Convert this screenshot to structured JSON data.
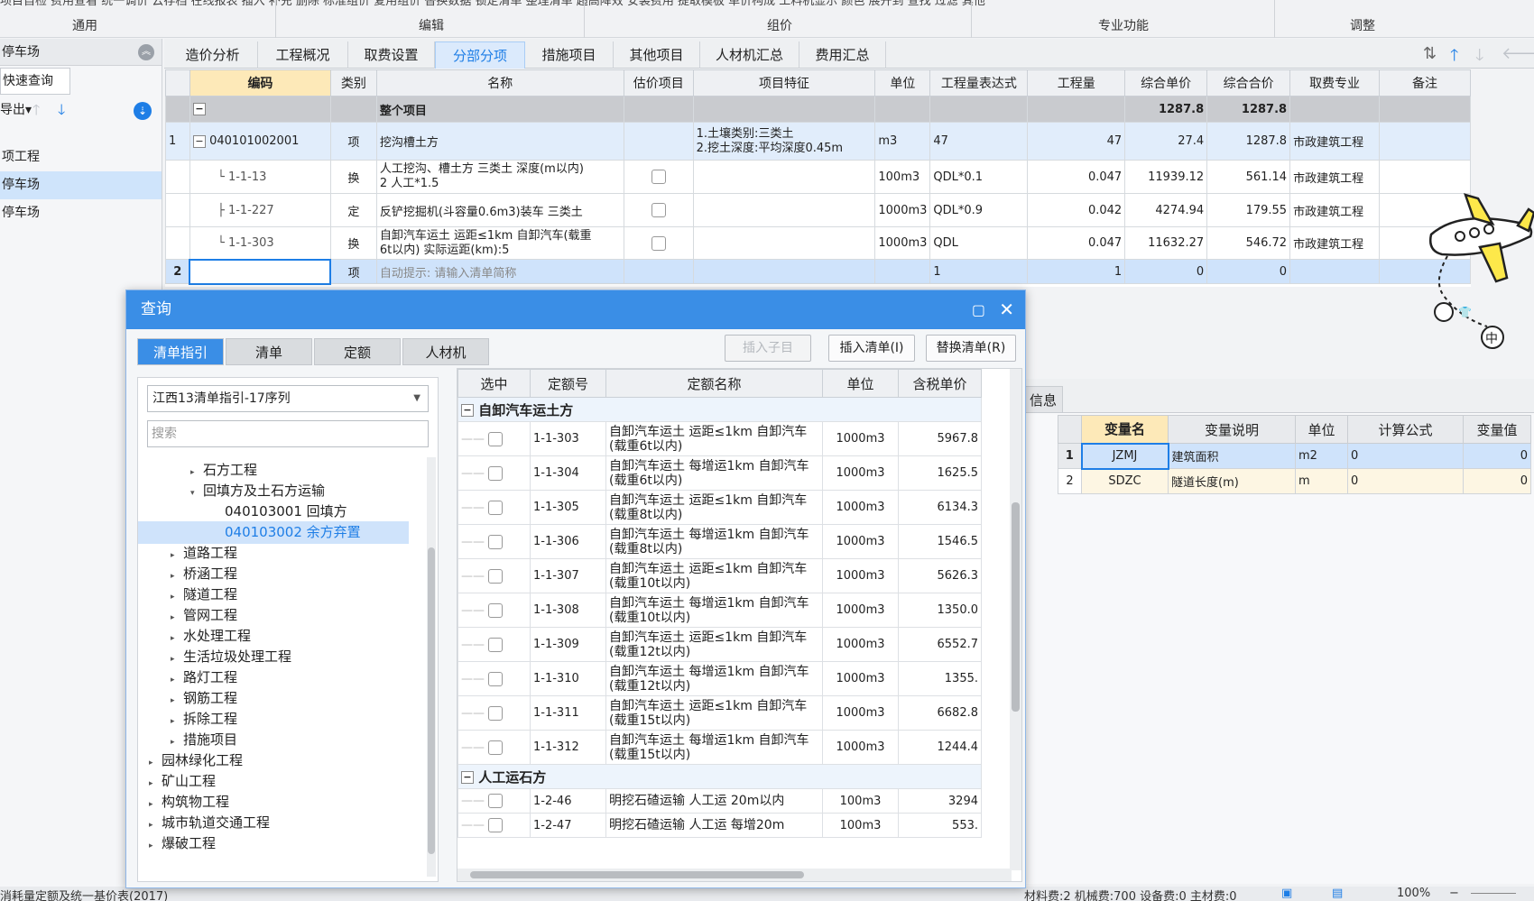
{
  "ribbon": {
    "truncated_top": "项目自检   费用查看   统一调价   云存档   在线报表   插入   补充   删除   标准组价   复用组价   替换数据   锁定清单   整理清单   超高降效   安装费用   提取模板   单价构成   工料机显示   颜色   展开到   查找   过滤   其他",
    "groups": [
      "通用",
      "编辑",
      "组价",
      "专业功能",
      "调整"
    ]
  },
  "left_panel": {
    "header": "停车场",
    "quick_query": "快速查询",
    "export": "导出",
    "items": [
      {
        "label": "项工程",
        "selected": false
      },
      {
        "label": "停车场",
        "selected": true
      },
      {
        "label": "停车场",
        "selected": false
      }
    ]
  },
  "tabs": [
    "造价分析",
    "工程概况",
    "取费设置",
    "分部分项",
    "措施项目",
    "其他项目",
    "人材机汇总",
    "费用汇总"
  ],
  "active_tab": "分部分项",
  "main_grid": {
    "headers": [
      "编码",
      "类别",
      "名称",
      "估价项目",
      "项目特征",
      "单位",
      "工程量表达式",
      "工程量",
      "综合单价",
      "综合合价",
      "取费专业",
      "备注"
    ],
    "total_row": {
      "toggle": "−",
      "name": "整个项目",
      "unit_price": "1287.8",
      "total": "1287.8"
    },
    "row1": {
      "index": "1",
      "toggle": "−",
      "code": "040101002001",
      "type": "项",
      "name": "挖沟槽土方",
      "feature1": "1.土壤类别:三类土",
      "feature2": "2.挖土深度:平均深度0.45m",
      "unit": "m3",
      "expr": "47",
      "qty": "47",
      "unit_price": "27.4",
      "total": "1287.8",
      "category": "市政建筑工程"
    },
    "subrows": [
      {
        "code": "1-1-13",
        "type": "换",
        "name1": "人工挖沟、槽土方 三类土 深度(m以内)",
        "name2": "2  人工*1.5",
        "unit": "100m3",
        "expr": "QDL*0.1",
        "qty": "0.047",
        "unit_price": "11939.12",
        "total": "561.14",
        "category": "市政建筑工程"
      },
      {
        "code": "1-1-227",
        "type": "定",
        "name1": "反铲挖掘机(斗容量0.6m3)装车 三类土",
        "name2": "",
        "unit": "1000m3",
        "expr": "QDL*0.9",
        "qty": "0.042",
        "unit_price": "4274.94",
        "total": "179.55",
        "category": "市政建筑工程"
      },
      {
        "code": "1-1-303",
        "type": "换",
        "name1": "自卸汽车运土 运距≤1km 自卸汽车(载重",
        "name2": "6t以内) 实际运距(km):5",
        "unit": "1000m3",
        "expr": "QDL",
        "qty": "0.047",
        "unit_price": "11632.27",
        "total": "546.72",
        "category": "市政建筑工程"
      }
    ],
    "row2": {
      "index": "2",
      "type": "项",
      "hint": "自动提示: 请输入清单简称",
      "expr": "1",
      "qty": "1",
      "unit_price": "0",
      "total": "0"
    }
  },
  "right_panel": {
    "tab": "信息",
    "headers": [
      "变量名",
      "变量说明",
      "单位",
      "计算公式",
      "变量值"
    ],
    "rows": [
      {
        "idx": "1",
        "name": "JZMJ",
        "desc": "建筑面积",
        "unit": "m2",
        "formula": "0",
        "value": "0"
      },
      {
        "idx": "2",
        "name": "SDZC",
        "desc": "隧道长度(m)",
        "unit": "m",
        "formula": "0",
        "value": "0"
      }
    ]
  },
  "mascot_label": "中",
  "dialog": {
    "title": "查询",
    "tabs": [
      "清单指引",
      "清单",
      "定额",
      "人材机"
    ],
    "buttons": {
      "insert_child": "插入子目",
      "insert_list": "插入清单(I)",
      "replace_list": "替换清单(R)"
    },
    "select_value": "江西13清单指引-17序列",
    "search_placeholder": "搜索",
    "tree": [
      {
        "label": "石方工程",
        "level": 2,
        "icon": "▸",
        "selected": false
      },
      {
        "label": "回填方及土石方运输",
        "level": 2,
        "icon": "▾",
        "selected": false
      },
      {
        "label": "040103001  回填方",
        "level": 3,
        "icon": "",
        "selected": false
      },
      {
        "label": "040103002  余方弃置",
        "level": 3,
        "icon": "",
        "selected": true
      },
      {
        "label": "道路工程",
        "level": 1,
        "icon": "▸",
        "selected": false
      },
      {
        "label": "桥涵工程",
        "level": 1,
        "icon": "▸",
        "selected": false
      },
      {
        "label": "隧道工程",
        "level": 1,
        "icon": "▸",
        "selected": false
      },
      {
        "label": "管网工程",
        "level": 1,
        "icon": "▸",
        "selected": false
      },
      {
        "label": "水处理工程",
        "level": 1,
        "icon": "▸",
        "selected": false
      },
      {
        "label": "生活垃圾处理工程",
        "level": 1,
        "icon": "▸",
        "selected": false
      },
      {
        "label": "路灯工程",
        "level": 1,
        "icon": "▸",
        "selected": false
      },
      {
        "label": "钢筋工程",
        "level": 1,
        "icon": "▸",
        "selected": false
      },
      {
        "label": "拆除工程",
        "level": 1,
        "icon": "▸",
        "selected": false
      },
      {
        "label": "措施项目",
        "level": 1,
        "icon": "▸",
        "selected": false
      },
      {
        "label": "园林绿化工程",
        "level": 0,
        "icon": "▸",
        "selected": false
      },
      {
        "label": "矿山工程",
        "level": 0,
        "icon": "▸",
        "selected": false
      },
      {
        "label": "构筑物工程",
        "level": 0,
        "icon": "▸",
        "selected": false
      },
      {
        "label": "城市轨道交通工程",
        "level": 0,
        "icon": "▸",
        "selected": false
      },
      {
        "label": "爆破工程",
        "level": 0,
        "icon": "▸",
        "selected": false
      }
    ],
    "grid_headers": [
      "选中",
      "定额号",
      "定额名称",
      "单位",
      "含税单价"
    ],
    "groups": [
      {
        "name": "自卸汽车运土方",
        "rows": [
          {
            "code": "1-1-303",
            "name1": "自卸汽车运土 运距≤1km 自卸汽车",
            "name2": "(载重6t以内)",
            "unit": "1000m3",
            "price": "5967.8"
          },
          {
            "code": "1-1-304",
            "name1": "自卸汽车运土 每增运1km 自卸汽车",
            "name2": "(载重6t以内)",
            "unit": "1000m3",
            "price": "1625.5"
          },
          {
            "code": "1-1-305",
            "name1": "自卸汽车运土 运距≤1km 自卸汽车",
            "name2": "(载重8t以内)",
            "unit": "1000m3",
            "price": "6134.3"
          },
          {
            "code": "1-1-306",
            "name1": "自卸汽车运土 每增运1km 自卸汽车",
            "name2": "(载重8t以内)",
            "unit": "1000m3",
            "price": "1546.5"
          },
          {
            "code": "1-1-307",
            "name1": "自卸汽车运土 运距≤1km 自卸汽车",
            "name2": "(载重10t以内)",
            "unit": "1000m3",
            "price": "5626.3"
          },
          {
            "code": "1-1-308",
            "name1": "自卸汽车运土 每增运1km 自卸汽车",
            "name2": "(载重10t以内)",
            "unit": "1000m3",
            "price": "1350.0"
          },
          {
            "code": "1-1-309",
            "name1": "自卸汽车运土 运距≤1km 自卸汽车",
            "name2": "(载重12t以内)",
            "unit": "1000m3",
            "price": "6552.7"
          },
          {
            "code": "1-1-310",
            "name1": "自卸汽车运土 每增运1km 自卸汽车",
            "name2": "(载重12t以内)",
            "unit": "1000m3",
            "price": "1355."
          },
          {
            "code": "1-1-311",
            "name1": "自卸汽车运土 运距≤1km 自卸汽车",
            "name2": "(载重15t以内)",
            "unit": "1000m3",
            "price": "6682.8"
          },
          {
            "code": "1-1-312",
            "name1": "自卸汽车运土 每增运1km 自卸汽车",
            "name2": "(载重15t以内)",
            "unit": "1000m3",
            "price": "1244.4"
          }
        ]
      },
      {
        "name": "人工运石方",
        "rows": [
          {
            "code": "1-2-46",
            "name1": "明挖石碴运输 人工运 20m以内",
            "name2": "",
            "unit": "100m3",
            "price": "3294"
          },
          {
            "code": "1-2-47",
            "name1": "明挖石碴运输 人工运 每增20m",
            "name2": "",
            "unit": "100m3",
            "price": "553."
          }
        ]
      }
    ]
  },
  "status_bar": {
    "left": "消耗量定额及统一基价表(2017)",
    "right": "材料费:2  机械费:700  设备费:0  主材费:0",
    "zoom": "100%"
  }
}
